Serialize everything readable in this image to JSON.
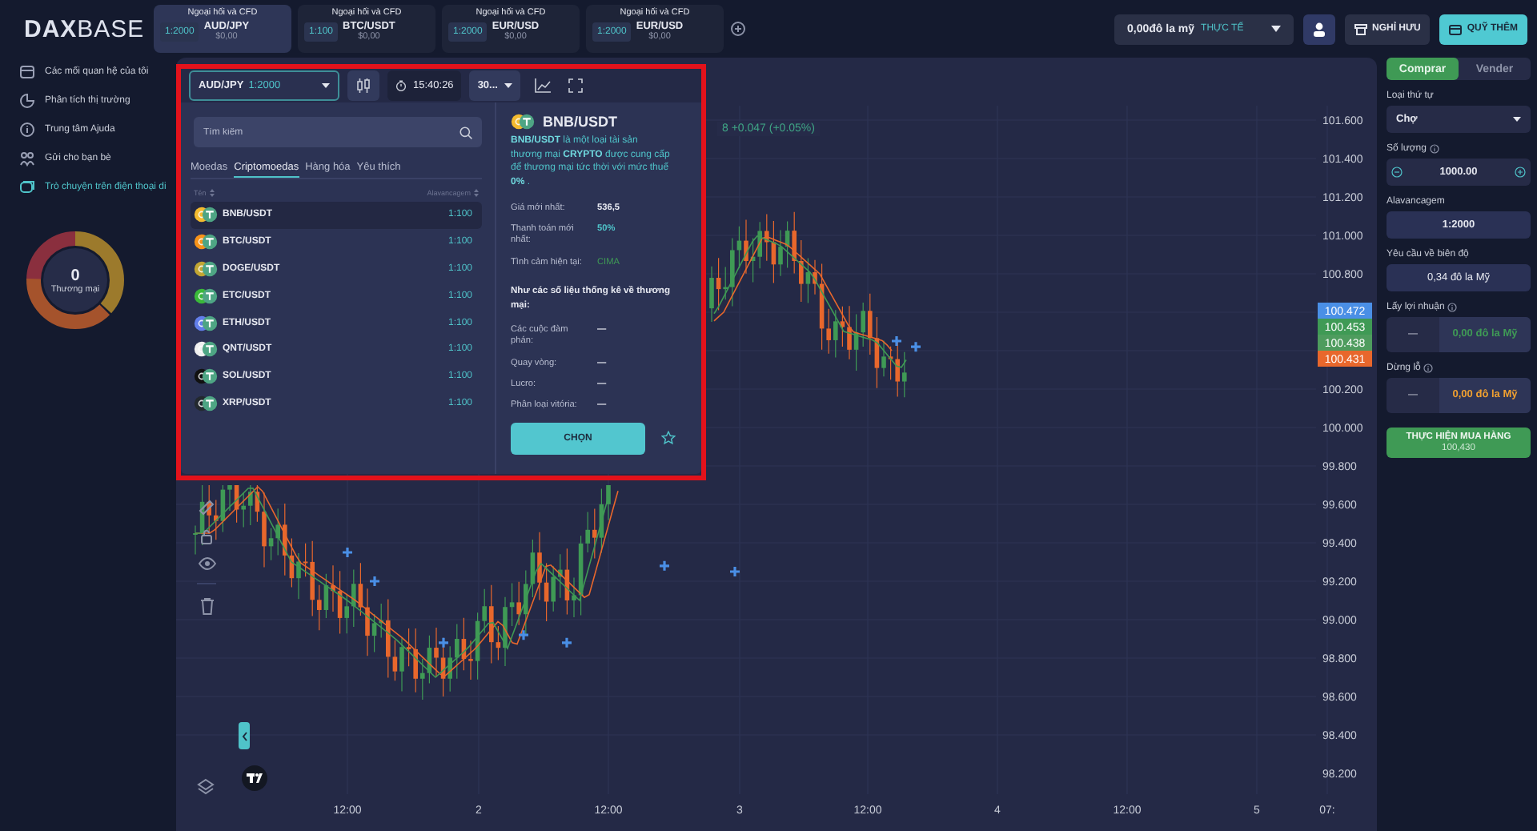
{
  "header": {
    "logo": "**DAX**BASE",
    "tabs": [
      {
        "category": "Ngoại hối và CFD",
        "leverage": "1:2000",
        "symbol": "AUD/JPY",
        "balance": "$0,00",
        "selected": true
      },
      {
        "category": "Ngoại hối và CFD",
        "leverage": "1:100",
        "symbol": "BTC/USDT",
        "balance": "$0,00",
        "selected": false
      },
      {
        "category": "Ngoại hối và CFD",
        "leverage": "1:2000",
        "symbol": "EUR/USD",
        "balance": "$0,00",
        "selected": false
      },
      {
        "category": "Ngoại hối và CFD",
        "leverage": "1:2000",
        "symbol": "EUR/USD",
        "balance": "$0,00",
        "selected": false
      }
    ],
    "account": {
      "balance": "0,00đô la mỹ",
      "mode": "THỰC TẾ"
    },
    "buttons": [
      {
        "label": "NGHỈ HƯU",
        "kind": "withdraw"
      },
      {
        "label": "QUỸ THÊM",
        "kind": "deposit"
      }
    ]
  },
  "sidebar": {
    "items": [
      {
        "label": "Các mối quan hệ của tôi",
        "kind": "calendar",
        "selected": false
      },
      {
        "label": "Phân tích thị trường",
        "kind": "pie",
        "selected": false
      },
      {
        "label": "Trung tâm Ajuda",
        "kind": "info",
        "selected": false
      },
      {
        "label": "Gửi cho bạn bè",
        "kind": "people",
        "selected": false
      },
      {
        "label": "Trò chuyện trên điện thoại di",
        "kind": "chat",
        "selected": true
      }
    ],
    "gauge": {
      "value": "0",
      "label": "Thương mại"
    }
  },
  "chart_toolbar": {
    "symbol": "AUD/JPY",
    "leverage": "1:2000",
    "clock": "15:40:26",
    "interval": "30..."
  },
  "chart": {
    "change": "8 +0.047 (+0.05%)",
    "price_axis": [
      "101.600",
      "101.400",
      "101.200",
      "101.000",
      "100.800",
      "100.200",
      "100.000",
      "99.800",
      "99.600",
      "99.400",
      "99.200",
      "99.000",
      "98.800",
      "98.600",
      "98.400",
      "98.200"
    ],
    "price_tags": [
      {
        "value": "100.472",
        "color": "#4a8fe6"
      },
      {
        "value": "100.453",
        "color": "#3f9a55"
      },
      {
        "value": "100.438",
        "color": "#4e9c5e"
      },
      {
        "value": "100.431",
        "color": "#e8672c"
      }
    ],
    "time_axis": [
      "12:00",
      "2",
      "12:00",
      "3",
      "12:00",
      "4",
      "12:00",
      "5",
      "07:"
    ]
  },
  "asset_picker": {
    "search": {
      "placeholder": "Tìm kiếm"
    },
    "categories": [
      {
        "label": "Moedas",
        "selected": false
      },
      {
        "label": "Criptomoedas",
        "selected": true
      },
      {
        "label": "Hàng hóa",
        "selected": false
      },
      {
        "label": "Yêu thích",
        "selected": false
      }
    ],
    "columns": [
      "Tên",
      "Alavancagem"
    ],
    "rows": [
      {
        "symbol": "BNB/USDT",
        "leverage": "1:100",
        "color": "#f3ba2f",
        "selected": true
      },
      {
        "symbol": "BTC/USDT",
        "leverage": "1:100",
        "color": "#f7931a",
        "selected": false
      },
      {
        "symbol": "DOGE/USDT",
        "leverage": "1:100",
        "color": "#c2a633",
        "selected": false
      },
      {
        "symbol": "ETC/USDT",
        "leverage": "1:100",
        "color": "#3ab83a",
        "selected": false
      },
      {
        "symbol": "ETH/USDT",
        "leverage": "1:100",
        "color": "#627eea",
        "selected": false
      },
      {
        "symbol": "QNT/USDT",
        "leverage": "1:100",
        "color": "#f0f0f0",
        "selected": false
      },
      {
        "symbol": "SOL/USDT",
        "leverage": "1:100",
        "color": "#111111",
        "selected": false
      },
      {
        "symbol": "XRP/USDT",
        "leverage": "1:100",
        "color": "#23292f",
        "selected": false
      }
    ],
    "details": {
      "symbol": "BNB/USDT",
      "color": "#f3ba2f",
      "description": "**BNB/USDT** là một loại tài sản thương mại **CRYPTO** được cung cấp để thương mại tức thời với mức thuế **0%** .",
      "stats": [
        {
          "label": "Giá mới nhất:",
          "value": "536,5",
          "kind": "plain"
        },
        {
          "label": "Thanh toán mới nhất:",
          "value": "50%",
          "kind": "accent"
        },
        {
          "label": "Tình cảm hiện tại:",
          "value": "CIMA",
          "kind": "positive"
        }
      ],
      "stats_heading": "Như các số liệu thống kê về thương mại:",
      "trade_stats": [
        {
          "label": "Các cuộc đàm phán:",
          "value": "—"
        },
        {
          "label": "Quay vòng:",
          "value": "—"
        },
        {
          "label": "Lucro:",
          "value": "—"
        },
        {
          "label": "Phân loại vitória:",
          "value": "—"
        }
      ],
      "select_button": "CHỌN"
    }
  },
  "order": {
    "sides": [
      {
        "label": "Comprar",
        "selected": true
      },
      {
        "label": "Vender",
        "selected": false
      }
    ],
    "fields": [
      {
        "kind": "select",
        "label": "Loại thứ tự",
        "info": false,
        "value": "Chợ"
      },
      {
        "kind": "stepper",
        "label": "Số lượng",
        "info": true,
        "value": "1000.00"
      },
      {
        "kind": "value",
        "label": "Alavancagem",
        "info": false,
        "value": "1:2000",
        "strong": true
      },
      {
        "kind": "value",
        "label": "Yêu cầu về biên độ",
        "info": false,
        "value": "0,34 đô la Mỹ",
        "strong": false
      },
      {
        "kind": "split",
        "label": "Lấy lợi nhuận",
        "info": true,
        "left": "—",
        "value": "0,00 đô la Mỹ",
        "loss": false
      },
      {
        "kind": "split",
        "label": "Dừng lỗ",
        "info": true,
        "left": "—",
        "value": "0,00 đô la Mỹ",
        "loss": true
      }
    ],
    "submit": {
      "label": "THỰC HIỆN MUA HÀNG",
      "price": "100,430"
    }
  }
}
